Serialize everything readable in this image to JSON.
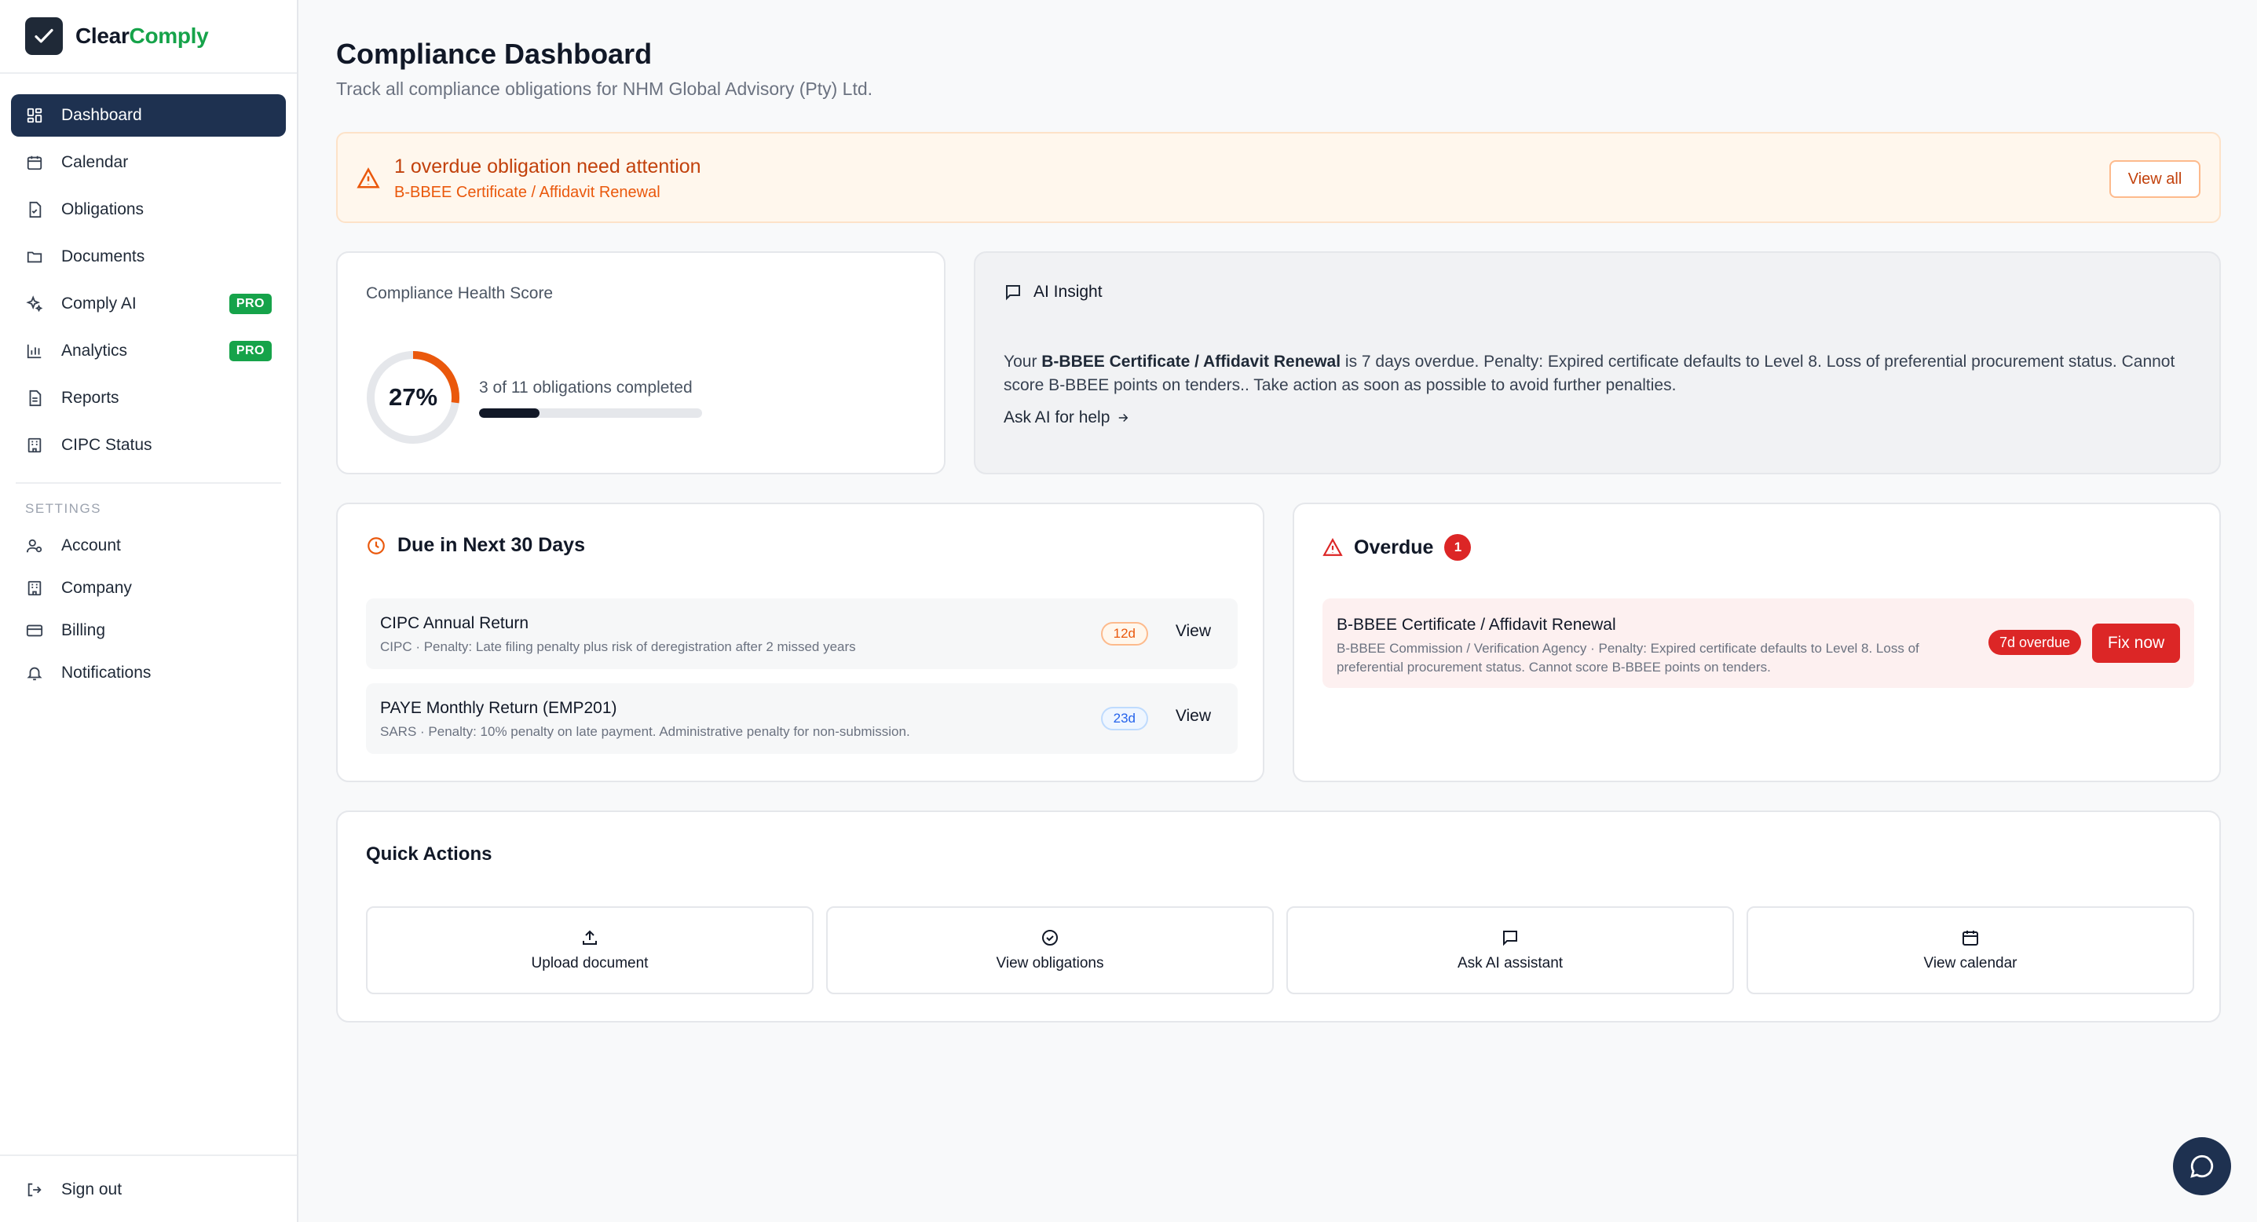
{
  "brand": {
    "name_part1": "Clear",
    "name_part2": "Comply",
    "logo_icon": "check-icon"
  },
  "sidebar": {
    "items": [
      {
        "label": "Dashboard",
        "icon": "grid-icon",
        "active": true
      },
      {
        "label": "Calendar",
        "icon": "calendar-icon"
      },
      {
        "label": "Obligations",
        "icon": "document-check-icon"
      },
      {
        "label": "Documents",
        "icon": "folder-icon"
      },
      {
        "label": "Comply AI",
        "icon": "sparkles-icon",
        "badge": "PRO"
      },
      {
        "label": "Analytics",
        "icon": "bar-chart-icon",
        "badge": "PRO"
      },
      {
        "label": "Reports",
        "icon": "report-icon"
      },
      {
        "label": "CIPC Status",
        "icon": "building-icon"
      }
    ],
    "settings_heading": "SETTINGS",
    "settings_items": [
      {
        "label": "Account",
        "icon": "user-cog-icon"
      },
      {
        "label": "Company",
        "icon": "building-icon"
      },
      {
        "label": "Billing",
        "icon": "credit-card-icon"
      },
      {
        "label": "Notifications",
        "icon": "bell-icon"
      }
    ],
    "signout_label": "Sign out"
  },
  "header": {
    "title": "Compliance Dashboard",
    "subtitle": "Track all compliance obligations for NHM Global Advisory (Pty) Ltd."
  },
  "alert": {
    "title": "1 overdue obligation need attention",
    "subtitle": "B-BBEE Certificate / Affidavit Renewal",
    "button": "View all"
  },
  "health": {
    "title": "Compliance Health Score",
    "score_label": "27%",
    "score_fraction": 0.27,
    "count_text": "3 of 11 obligations completed",
    "progress_fraction": 0.27
  },
  "insight": {
    "title": "AI Insight",
    "text_prefix": "Your ",
    "text_bold": "B-BBEE Certificate / Affidavit Renewal",
    "text_suffix": " is 7 days overdue. Penalty: Expired certificate defaults to Level 8. Loss of preferential procurement status. Cannot score B-BBEE points on tenders.. Take action as soon as possible to avoid further penalties.",
    "link": "Ask AI for help"
  },
  "due": {
    "title": "Due in Next 30 Days",
    "rows": [
      {
        "title": "CIPC Annual Return",
        "sub": "CIPC · Penalty: Late filing penalty plus risk of deregistration after 2 missed years",
        "days": "12d",
        "action": "View"
      },
      {
        "title": "PAYE Monthly Return (EMP201)",
        "sub": "SARS · Penalty: 10% penalty on late payment. Administrative penalty for non-submission.",
        "days": "23d",
        "action": "View"
      }
    ]
  },
  "overdue": {
    "title": "Overdue",
    "count": "1",
    "row": {
      "title": "B-BBEE Certificate / Affidavit Renewal",
      "sub": "B-BBEE Commission / Verification Agency · Penalty: Expired certificate defaults to Level 8. Loss of preferential procurement status. Cannot score B-BBEE points on tenders.",
      "badge": "7d overdue",
      "action": "Fix now"
    }
  },
  "quick_actions": {
    "title": "Quick Actions",
    "items": [
      {
        "label": "Upload document",
        "icon": "upload-icon"
      },
      {
        "label": "View obligations",
        "icon": "check-circle-icon"
      },
      {
        "label": "Ask AI assistant",
        "icon": "message-icon"
      },
      {
        "label": "View calendar",
        "icon": "calendar-icon"
      }
    ]
  },
  "colors": {
    "primary": "#1e3150",
    "accent_green": "#16a34a",
    "danger": "#dc2626",
    "warning": "#ea580c"
  }
}
